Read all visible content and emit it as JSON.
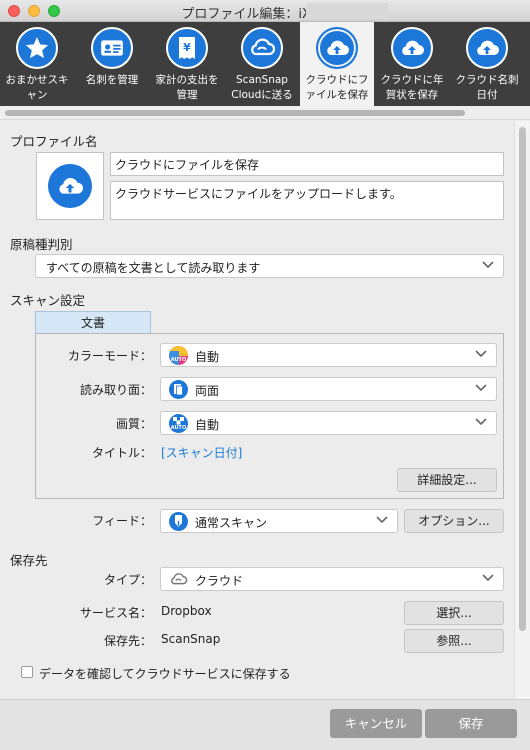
{
  "window": {
    "title": "プロファイル編集：iX1500-"
  },
  "toolbar": {
    "items": [
      {
        "label": "おまかせスキ\nャン",
        "icon": "star-icon"
      },
      {
        "label": "名刺を管理",
        "icon": "business-card-icon"
      },
      {
        "label": "家計の支出を\n管理",
        "icon": "receipt-icon"
      },
      {
        "label": "ScanSnap\nCloudに送る",
        "icon": "scansnap-cloud-icon"
      },
      {
        "label": "クラウドにフ\nァイルを保存",
        "icon": "cloud-upload-icon",
        "active": true
      },
      {
        "label": "クラウドに年\n賀状を保存",
        "icon": "cloud-upload-icon"
      },
      {
        "label": "クラウド名刺\n日付",
        "icon": "cloud-upload-icon"
      }
    ]
  },
  "profile": {
    "section_label": "プロファイル名",
    "name_value": "クラウドにファイルを保存",
    "description_value": "クラウドサービスにファイルをアップロードします。"
  },
  "document_type": {
    "section_label": "原稿種判別",
    "selected": "すべての原稿を文書として読み取ります"
  },
  "scan_settings": {
    "section_label": "スキャン設定",
    "tab_label": "文書",
    "color_mode": {
      "label": "カラーモード：",
      "value": "自動",
      "icon_text": "AUTO"
    },
    "scan_side": {
      "label": "読み取り面：",
      "value": "両面"
    },
    "quality": {
      "label": "画質：",
      "value": "自動",
      "icon_text": "AUTO"
    },
    "title": {
      "label": "タイトル：",
      "value": "[スキャン日付]"
    },
    "details_button": "詳細設定..."
  },
  "feed": {
    "label": "フィード：",
    "value": "通常スキャン",
    "options_button": "オプション..."
  },
  "destination": {
    "section_label": "保存先",
    "type_label": "タイプ：",
    "type_value": "クラウド",
    "service_label": "サービス名：",
    "service_value": "Dropbox",
    "select_button": "選択...",
    "folder_label": "保存先：",
    "folder_value": "ScanSnap",
    "browse_button": "参照...",
    "confirm_checkbox_label": "データを確認してクラウドサービスに保存する",
    "confirm_checked": false
  },
  "footer": {
    "cancel_label": "キャンセル",
    "save_label": "保存"
  },
  "colors": {
    "accent": "#1d77d9",
    "toolbar_bg": "#3e3e3e",
    "link": "#1a7bd8",
    "color_auto_icon": "#e8357a"
  }
}
